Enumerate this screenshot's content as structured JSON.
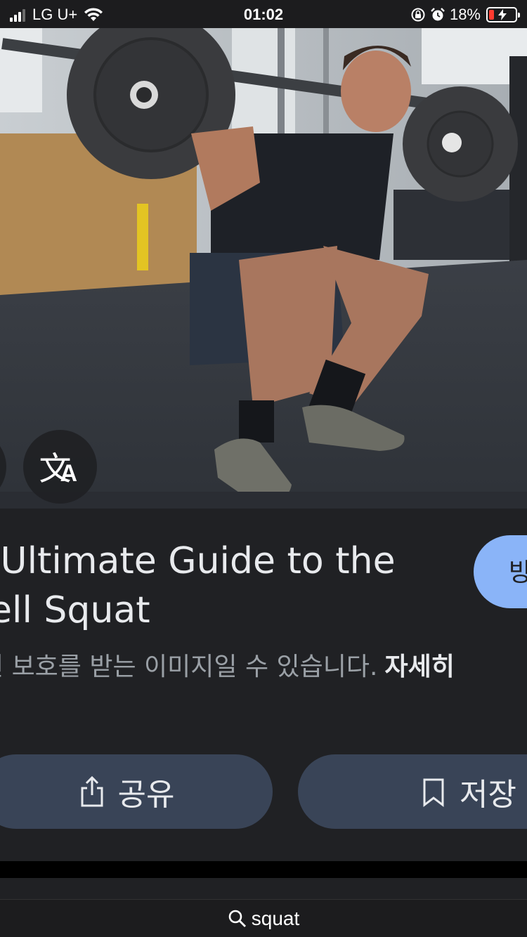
{
  "status_bar": {
    "carrier": "LG U+",
    "time": "01:02",
    "battery_percent": "18%",
    "battery_level": 0.18,
    "signal_bars": 3
  },
  "image": {
    "alt": "Man performing barbell back squat in a gym"
  },
  "result": {
    "title": "e Ultimate Guide to the\nbell Squat",
    "visit_label": "방",
    "notice_text": "권 보호를 받는 이미지일 수 있습니다.",
    "notice_link": "자세히"
  },
  "actions": {
    "share_label": "공유",
    "save_label": "저장"
  },
  "search": {
    "query": "squat"
  },
  "colors": {
    "background": "#202124",
    "accent": "#8ab4f8",
    "action_button": "#394457",
    "battery_low": "#ff3b30"
  }
}
